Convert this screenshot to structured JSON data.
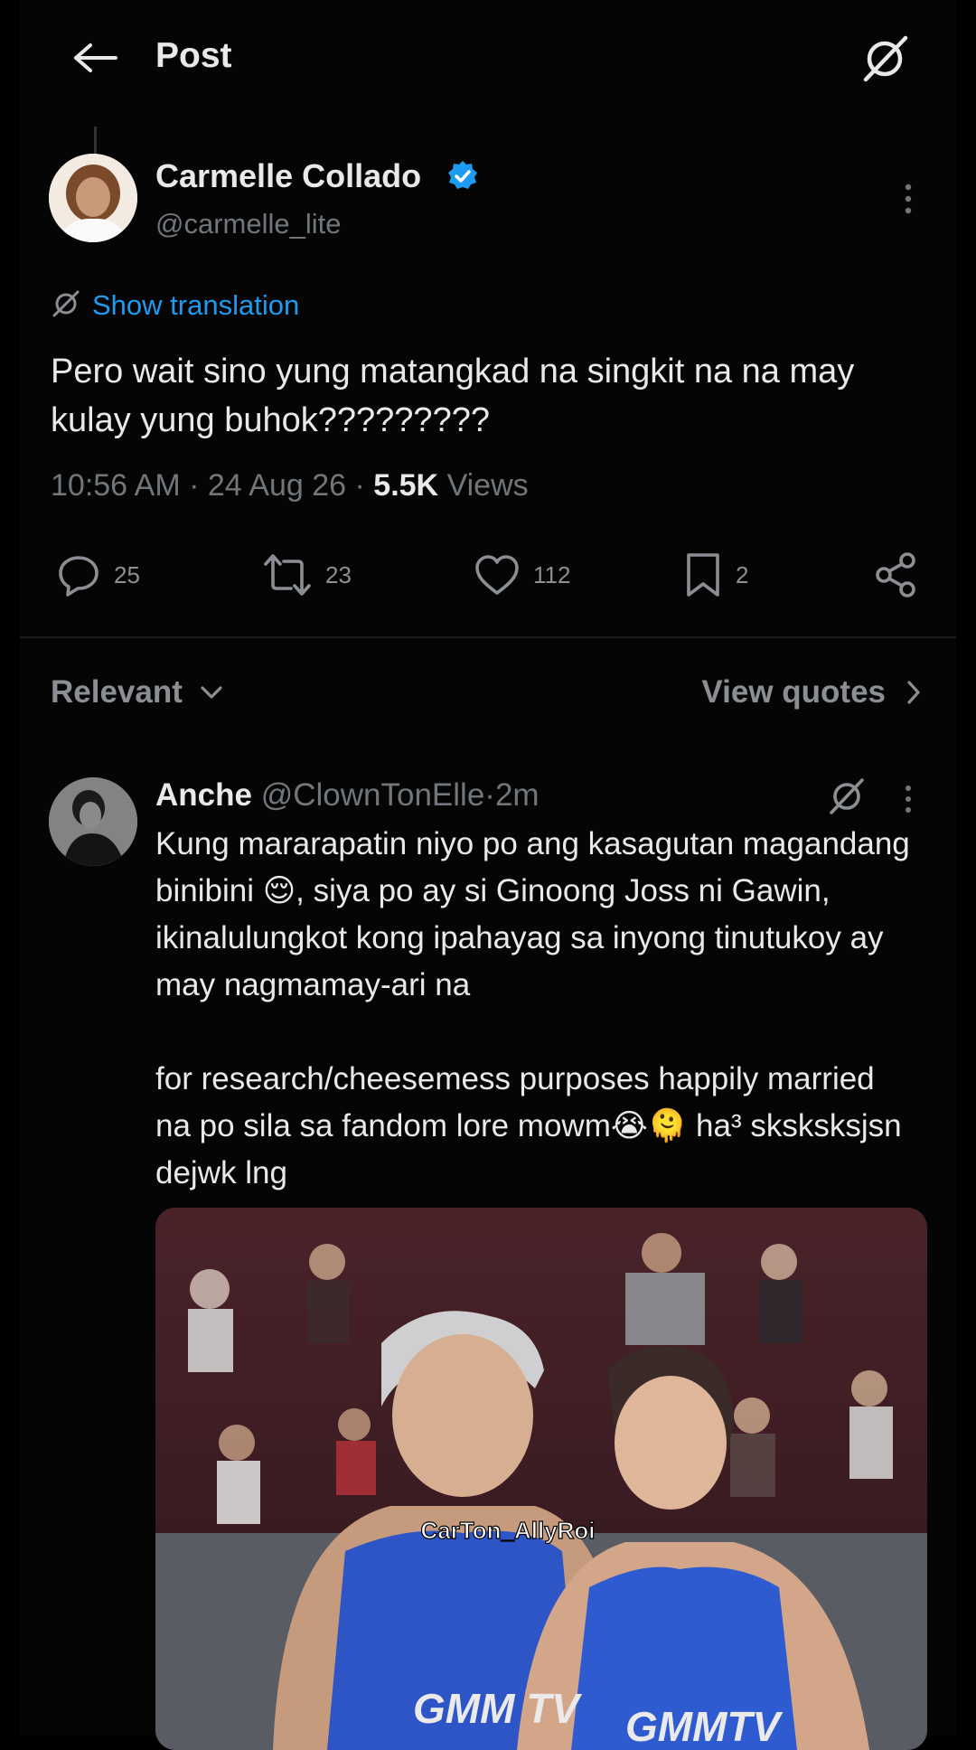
{
  "header": {
    "title": "Post"
  },
  "post": {
    "author_name": "Carmelle Collado",
    "author_handle": "@carmelle_lite",
    "translate_label": "Show translation",
    "text": "Pero wait sino yung matangkad na singkit na na may kulay yung buhok?????????",
    "time": "10:56 AM",
    "date": "24 Aug 26",
    "views_count": "5.5K",
    "views_label": "Views",
    "separator": "·",
    "stats": {
      "replies": "25",
      "reposts": "23",
      "likes": "112",
      "bookmarks": "2"
    }
  },
  "sort": {
    "label": "Relevant",
    "quotes_label": "View quotes"
  },
  "reply": {
    "name": "Anche",
    "handle": "@ClownTonElle",
    "age": "2m",
    "text": "Kung mararapatin niyo po ang kasagutan magandang binibini 😌, siya po ay si Ginoong Joss ni Gawin, ikinalulungkot kong ipahayag sa inyong tinutukoy ay may nagmamay-ari na\n\nfor research/cheesemess purposes happily married na po sila sa fandom lore mowm😭🫠 ha³ sksksksjsn dejwk lng",
    "media": {
      "watermark": "CarTon_AllyRoi",
      "jersey_text_left": "GMM TV",
      "jersey_text_right": "GMMTV"
    }
  },
  "colors": {
    "background": "#000000",
    "text": "#e7e9ea",
    "muted": "#71767b",
    "accent": "#1d9bf0"
  },
  "icons": [
    "back-arrow-icon",
    "grok-icon",
    "verified-icon",
    "more-icon",
    "translate-icon",
    "reply-icon",
    "repost-icon",
    "like-icon",
    "bookmark-icon",
    "share-icon",
    "chevron-down-icon",
    "chevron-right-icon"
  ]
}
